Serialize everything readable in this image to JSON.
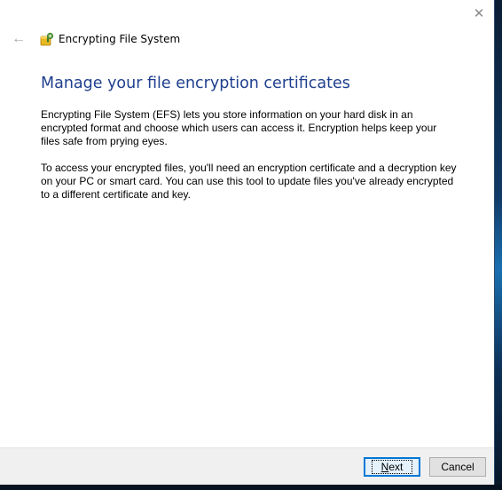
{
  "window": {
    "close_glyph": "✕",
    "back_glyph": "←",
    "title": "Encrypting File System",
    "app_icon": "efs-key-icon"
  },
  "main": {
    "heading": "Manage your file encryption certificates",
    "paragraph1": "Encrypting File System (EFS) lets you store information on your hard disk in an encrypted format and choose which users can access it. Encryption helps keep your files safe from prying eyes.",
    "paragraph2": "To access your encrypted files, you'll need an encryption certificate and a decryption key on your PC or smart card. You can use this tool to update files you've already encrypted to a different certificate and key."
  },
  "footer": {
    "next_accel": "N",
    "next_rest": "ext",
    "cancel_label": "Cancel"
  },
  "colors": {
    "heading": "#1e3f8e",
    "focus_border": "#0078d7"
  }
}
